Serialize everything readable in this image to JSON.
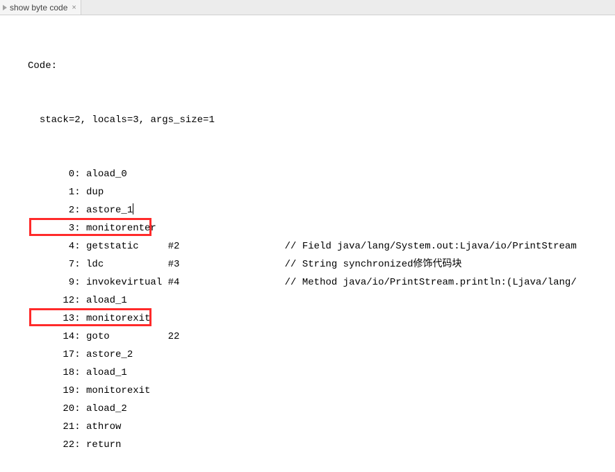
{
  "tab": {
    "title": "show byte code",
    "close_glyph": "×"
  },
  "header": {
    "code_label": "Code:",
    "meta": "stack=2, locals=3, args_size=1"
  },
  "lines": [
    {
      "offset": "0",
      "op": "aload_0",
      "arg": "",
      "comment": ""
    },
    {
      "offset": "1",
      "op": "dup",
      "arg": "",
      "comment": ""
    },
    {
      "offset": "2",
      "op": "astore_1",
      "arg": "",
      "comment": "",
      "caret": true
    },
    {
      "offset": "3",
      "op": "monitorenter",
      "arg": "",
      "comment": "",
      "highlight": true
    },
    {
      "offset": "4",
      "op": "getstatic",
      "arg": "#2",
      "comment": "// Field java/lang/System.out:Ljava/io/PrintStream"
    },
    {
      "offset": "7",
      "op": "ldc",
      "arg": "#3",
      "comment": "// String synchronized修饰代码块"
    },
    {
      "offset": "9",
      "op": "invokevirtual",
      "arg": "#4",
      "comment": "// Method java/io/PrintStream.println:(Ljava/lang/"
    },
    {
      "offset": "12",
      "op": "aload_1",
      "arg": "",
      "comment": ""
    },
    {
      "offset": "13",
      "op": "monitorexit",
      "arg": "",
      "comment": "",
      "highlight": true
    },
    {
      "offset": "14",
      "op": "goto",
      "arg": "22",
      "comment": ""
    },
    {
      "offset": "17",
      "op": "astore_2",
      "arg": "",
      "comment": ""
    },
    {
      "offset": "18",
      "op": "aload_1",
      "arg": "",
      "comment": ""
    },
    {
      "offset": "19",
      "op": "monitorexit",
      "arg": "",
      "comment": ""
    },
    {
      "offset": "20",
      "op": "aload_2",
      "arg": "",
      "comment": ""
    },
    {
      "offset": "21",
      "op": "athrow",
      "arg": "",
      "comment": ""
    },
    {
      "offset": "22",
      "op": "return",
      "arg": "",
      "comment": ""
    }
  ],
  "highlight_color": "#ff2a2a"
}
